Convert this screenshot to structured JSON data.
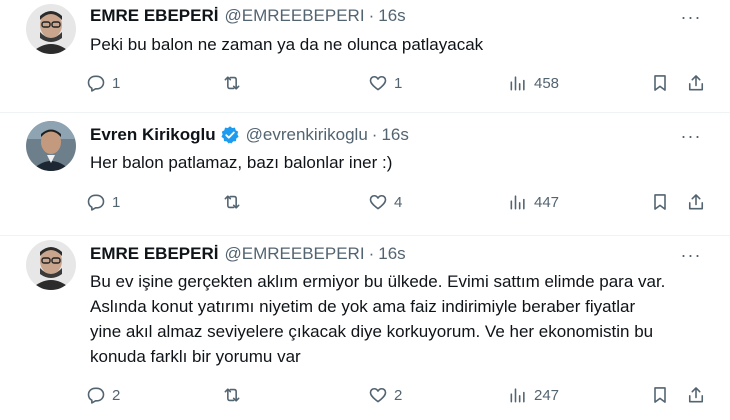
{
  "tweets": [
    {
      "name": "EMRE EBEPERİ",
      "handle": "@EMREEBEPERI",
      "dot": "·",
      "time": "16s",
      "verified": false,
      "text_lines": [
        "Peki bu balon ne zaman ya da ne olunca patlayacak"
      ],
      "reply_count": "1",
      "retweet_count": "",
      "like_count": "1",
      "view_count": "458",
      "more": "···"
    },
    {
      "name": "Evren Kirikoglu",
      "handle": "@evrenkirikoglu",
      "dot": "·",
      "time": "16s",
      "verified": true,
      "text_lines": [
        "Her balon patlamaz, bazı balonlar iner :)"
      ],
      "reply_count": "1",
      "retweet_count": "",
      "like_count": "4",
      "view_count": "447",
      "more": "···"
    },
    {
      "name": "EMRE EBEPERİ",
      "handle": "@EMREEBEPERI",
      "dot": "·",
      "time": "16s",
      "verified": false,
      "text_lines": [
        "Bu ev işine gerçekten aklım ermiyor bu ülkede. Evimi sattım elimde para var.",
        "Aslında konut yatırımı niyetim de yok ama faiz indirimiyle beraber fiyatlar",
        "yine akıl almaz seviyelere çıkacak diye korkuyorum. Ve her ekonomistin bu",
        "konuda farklı bir yorumu var"
      ],
      "reply_count": "2",
      "retweet_count": "",
      "like_count": "2",
      "view_count": "247",
      "more": "···"
    }
  ],
  "icons": {
    "reply": "reply-icon",
    "retweet": "retweet-icon",
    "like": "heart-icon",
    "views": "views-icon",
    "bookmark": "bookmark-icon",
    "share": "share-icon",
    "verified": "verified-badge-icon"
  },
  "colors": {
    "text": "#0f1419",
    "secondary": "#536471",
    "verified": "#1d9bf0",
    "divider": "#eff3f4"
  }
}
